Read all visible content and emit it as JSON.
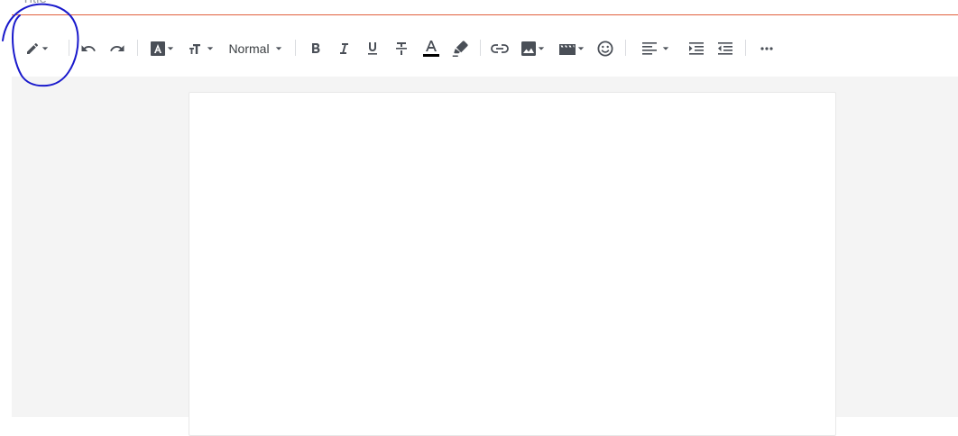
{
  "title": {
    "placeholder": "Title",
    "value": ""
  },
  "toolbar": {
    "text_style": "Normal",
    "icons": {
      "mode": "pencil-icon",
      "undo": "undo-icon",
      "redo": "redo-icon",
      "text_frame": "text-frame-icon",
      "font_size": "font-size-icon",
      "bold": "bold-icon",
      "italic": "italic-icon",
      "underline": "underline-icon",
      "strikethrough": "strikethrough-icon",
      "text_color": "text-color-icon",
      "highlight": "highlighter-icon",
      "link": "link-icon",
      "image": "image-icon",
      "video": "video-icon",
      "emoji": "emoji-icon",
      "align": "align-left-icon",
      "indent": "indent-icon",
      "outdent": "outdent-icon",
      "more": "more-icon"
    },
    "text_color_value": "#000000"
  },
  "colors": {
    "accent_underline": "#e0603c",
    "icon": "#4a4f57",
    "annotation_ink": "#1a1acc",
    "workspace": "#f4f4f4"
  },
  "editor": {
    "body": ""
  }
}
